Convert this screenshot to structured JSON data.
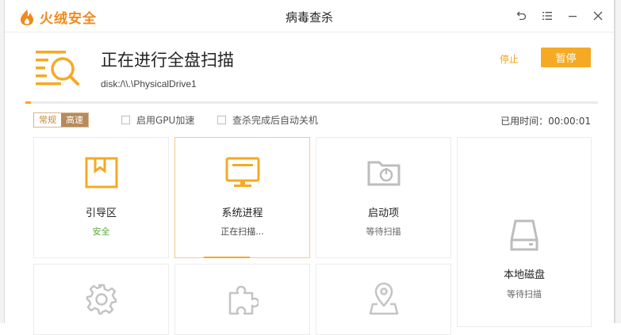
{
  "app": {
    "logo_text": "火绒安全",
    "window_title": "病毒查杀"
  },
  "colors": {
    "accent": "#f6a924",
    "safe": "#5aa43a",
    "icon_inactive": "#bdbdbd"
  },
  "header": {
    "title": "正在进行全盘扫描",
    "path": "disk:/\\\\.\\PhysicalDrive1",
    "stop_label": "停止",
    "pause_label": "暂停",
    "progress": 0.01
  },
  "options": {
    "mode_normal": "常规",
    "mode_fast": "高速",
    "gpu_label": "启用GPU加速",
    "shutdown_label": "查杀完成后自动关机",
    "elapsed_label": "已用时间：",
    "elapsed_value": "00:00:01"
  },
  "items": [
    {
      "name": "引导区",
      "status": "安全",
      "icon": "bookmark-box-icon"
    },
    {
      "name": "系统进程",
      "status": "正在扫描...",
      "icon": "monitor-icon"
    },
    {
      "name": "启动项",
      "status": "等待扫描",
      "icon": "power-folder-icon"
    },
    {
      "name": "本地磁盘",
      "status": "等待扫描",
      "icon": "hard-disk-icon"
    },
    {
      "name": "",
      "status": "",
      "icon": "gear-icon"
    },
    {
      "name": "",
      "status": "",
      "icon": "puzzle-icon"
    },
    {
      "name": "",
      "status": "",
      "icon": "location-pin-icon"
    }
  ]
}
